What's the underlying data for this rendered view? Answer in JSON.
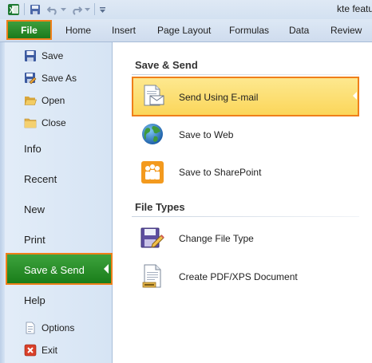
{
  "window": {
    "title": "kte featu"
  },
  "ribbon": {
    "file_tab": "File",
    "tabs": [
      "Home",
      "Insert",
      "Page Layout",
      "Formulas",
      "Data",
      "Review"
    ]
  },
  "backstage_nav": {
    "commands_top": [
      {
        "label": "Save",
        "icon": "save-icon"
      },
      {
        "label": "Save As",
        "icon": "save-as-icon"
      },
      {
        "label": "Open",
        "icon": "open-folder-icon"
      },
      {
        "label": "Close",
        "icon": "close-folder-icon"
      }
    ],
    "items": [
      "Info",
      "Recent",
      "New",
      "Print",
      "Save & Send",
      "Help"
    ],
    "selected": "Save & Send",
    "commands_bottom": [
      {
        "label": "Options",
        "icon": "options-icon"
      },
      {
        "label": "Exit",
        "icon": "exit-icon"
      }
    ]
  },
  "main": {
    "save_send_heading": "Save & Send",
    "save_send_options": [
      {
        "label": "Send Using E-mail",
        "icon": "email-icon",
        "selected": true
      },
      {
        "label": "Save to Web",
        "icon": "globe-icon"
      },
      {
        "label": "Save to SharePoint",
        "icon": "sharepoint-icon"
      }
    ],
    "file_types_heading": "File Types",
    "file_type_options": [
      {
        "label": "Change File Type",
        "icon": "change-file-type-icon"
      },
      {
        "label": "Create PDF/XPS Document",
        "icon": "pdf-xps-icon"
      }
    ]
  },
  "colors": {
    "highlight_border": "#ef7f1a",
    "file_green": "#2a8a2a",
    "selected_yellow": "#fbd65a"
  }
}
